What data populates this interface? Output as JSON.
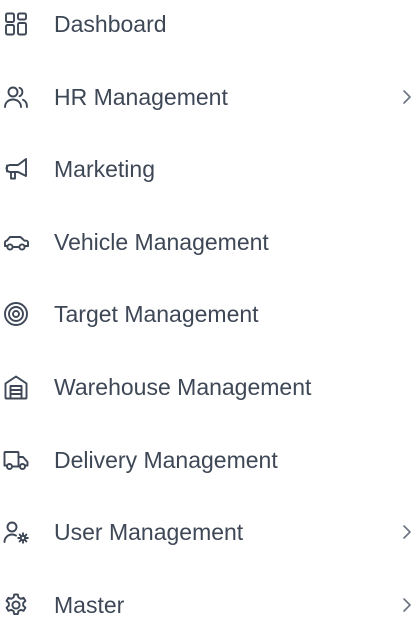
{
  "sidebar": {
    "items": [
      {
        "label": "Dashboard",
        "icon": "dashboard-icon",
        "has_submenu": false
      },
      {
        "label": "HR Management",
        "icon": "users-icon",
        "has_submenu": true
      },
      {
        "label": "Marketing",
        "icon": "megaphone-icon",
        "has_submenu": false
      },
      {
        "label": "Vehicle Management",
        "icon": "car-icon",
        "has_submenu": false
      },
      {
        "label": "Target Management",
        "icon": "target-icon",
        "has_submenu": false
      },
      {
        "label": "Warehouse Management",
        "icon": "warehouse-icon",
        "has_submenu": false
      },
      {
        "label": "Delivery Management",
        "icon": "truck-icon",
        "has_submenu": false
      },
      {
        "label": "User Management",
        "icon": "user-cog-icon",
        "has_submenu": true
      },
      {
        "label": "Master",
        "icon": "gear-icon",
        "has_submenu": true
      }
    ]
  },
  "colors": {
    "text": "#3e4756",
    "chevron": "#6b7280",
    "background": "#ffffff"
  }
}
